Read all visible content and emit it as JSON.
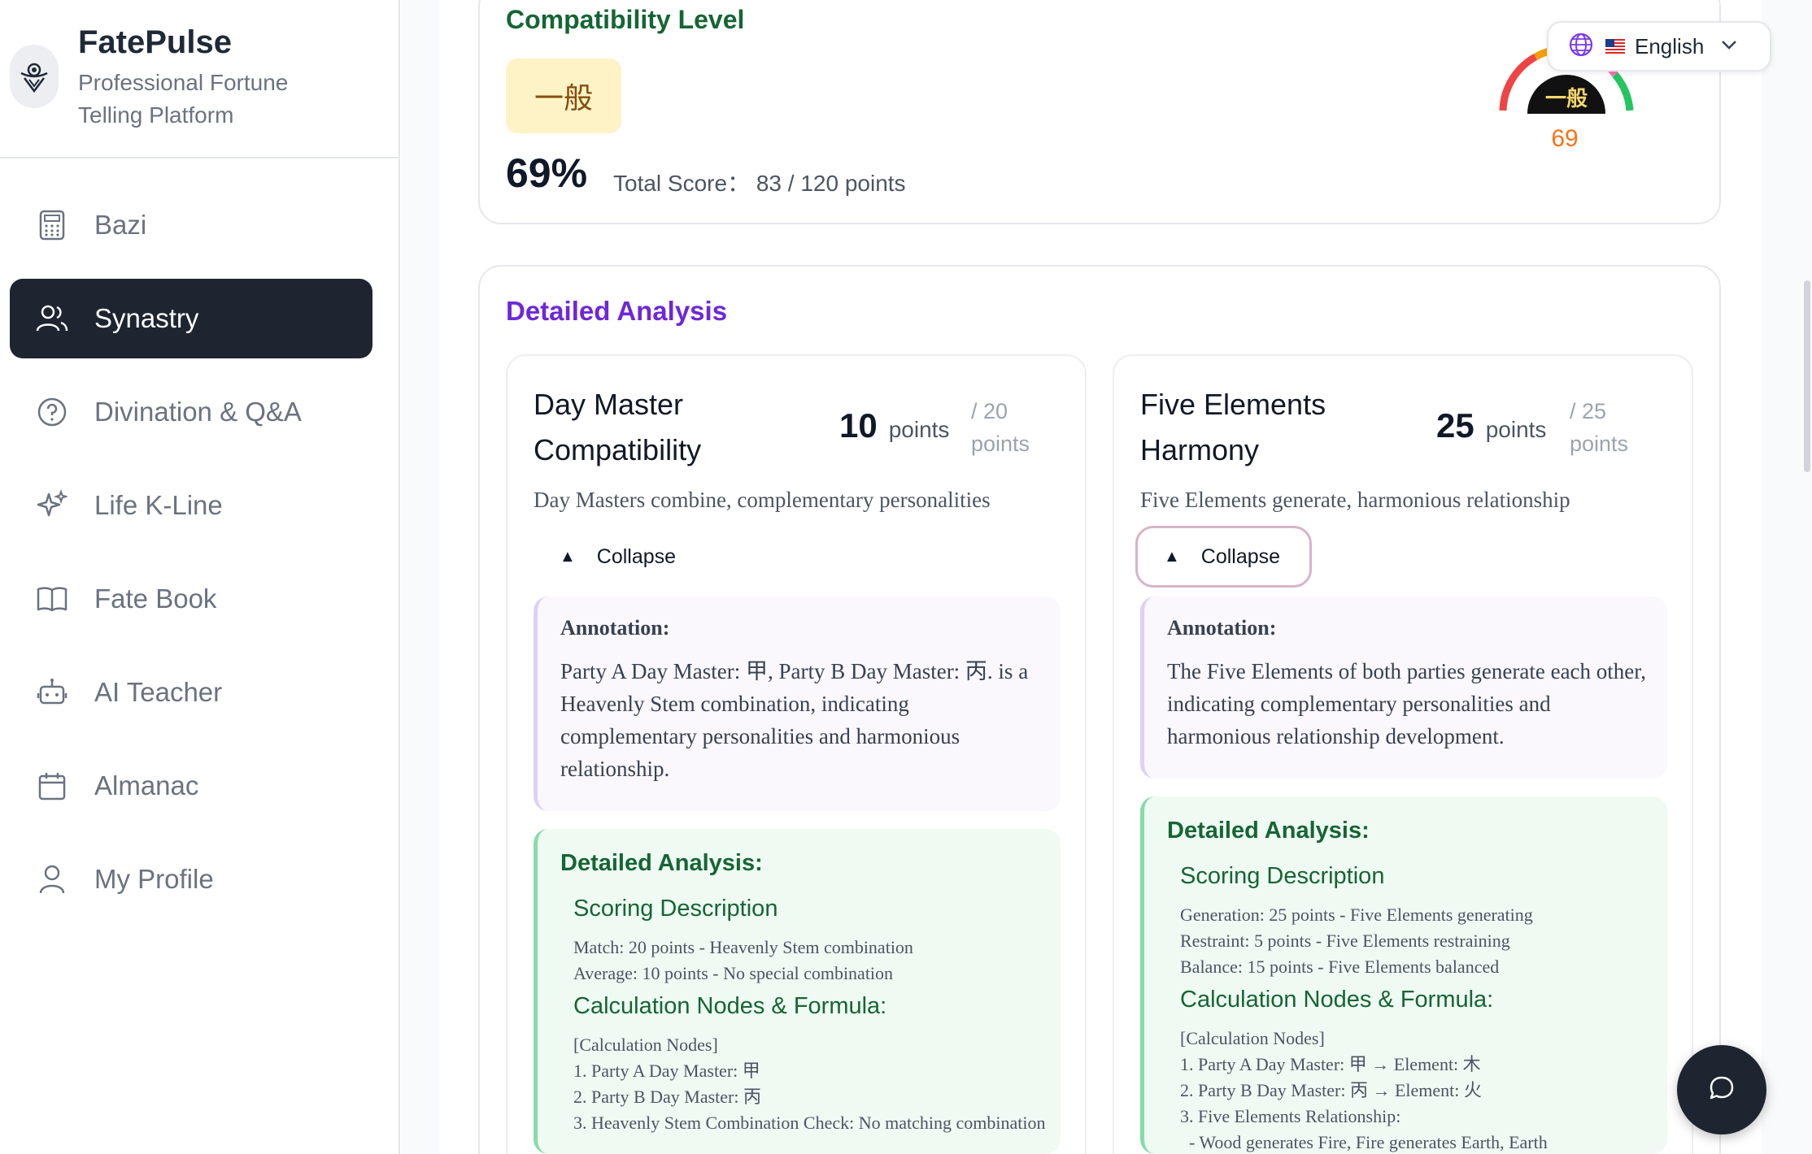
{
  "brand": {
    "name": "FatePulse",
    "subtitle": "Professional Fortune Telling Platform"
  },
  "sidebar": {
    "items": [
      {
        "label": "Bazi",
        "icon": "calculator-icon"
      },
      {
        "label": "Synastry",
        "icon": "users-icon",
        "active": true
      },
      {
        "label": "Divination & Q&A",
        "icon": "question-circle-icon"
      },
      {
        "label": "Life K-Line",
        "icon": "sparkles-icon"
      },
      {
        "label": "Fate Book",
        "icon": "book-icon"
      },
      {
        "label": "AI Teacher",
        "icon": "robot-icon"
      },
      {
        "label": "Almanac",
        "icon": "calendar-icon"
      },
      {
        "label": "My Profile",
        "icon": "user-icon"
      }
    ]
  },
  "language": {
    "label": "English",
    "icon": "globe-icon",
    "flag": "us-flag-icon"
  },
  "compatibility": {
    "title": "Compatibility Level",
    "level": "一般",
    "percent": "69%",
    "total_score": "Total Score：  83 / 120 points",
    "gauge_label": "一般",
    "gauge_value": "69",
    "gauge_fraction": 0.69,
    "colors": {
      "low": "#ef4444",
      "mid": "#f59e0b",
      "high": "#22c55e",
      "value": "#f97316"
    }
  },
  "detailed": {
    "title": "Detailed Analysis",
    "cards": [
      {
        "title": "Day Master Compatibility",
        "points": "10",
        "points_unit": "points",
        "max": "/ 20 points",
        "desc": "Day Masters combine, complementary personalities",
        "collapse": "Collapse",
        "annotation_head": "Annotation:",
        "annotation_text": "Party A Day Master: 甲, Party B Day Master: 丙. is a Heavenly Stem combination, indicating complementary personalities and harmonious relationship.",
        "analysis_head": "Detailed Analysis:",
        "scoring_title": "Scoring Description",
        "scoring_lines": [
          "Match: 20 points - Heavenly Stem combination",
          "Average: 10 points - No special combination"
        ],
        "calc_title": "Calculation Nodes & Formula:",
        "calc_lines": [
          "[Calculation Nodes]",
          "1. Party A Day Master: 甲",
          "2. Party B Day Master: 丙",
          "3. Heavenly Stem Combination Check: No matching combination"
        ]
      },
      {
        "title": "Five Elements Harmony",
        "points": "25",
        "points_unit": "points",
        "max": "/ 25 points",
        "desc": "Five Elements generate, harmonious relationship",
        "collapse": "Collapse",
        "annotation_head": "Annotation:",
        "annotation_text": "The Five Elements of both parties generate each other, indicating complementary personalities and harmonious relationship development.",
        "analysis_head": "Detailed Analysis:",
        "scoring_title": "Scoring Description",
        "scoring_lines": [
          "Generation: 25 points - Five Elements generating",
          "Restraint: 5 points - Five Elements restraining",
          "Balance: 15 points - Five Elements balanced"
        ],
        "calc_title": "Calculation Nodes & Formula:",
        "calc_lines": [
          "[Calculation Nodes]",
          "1. Party A Day Master: 甲 → Element: 木",
          "2. Party B Day Master: 丙 → Element: 火",
          "3. Five Elements Relationship:",
          "  - Wood generates Fire, Fire generates Earth, Earth"
        ]
      }
    ]
  },
  "chat": {
    "icon": "chat-bubble-icon"
  }
}
